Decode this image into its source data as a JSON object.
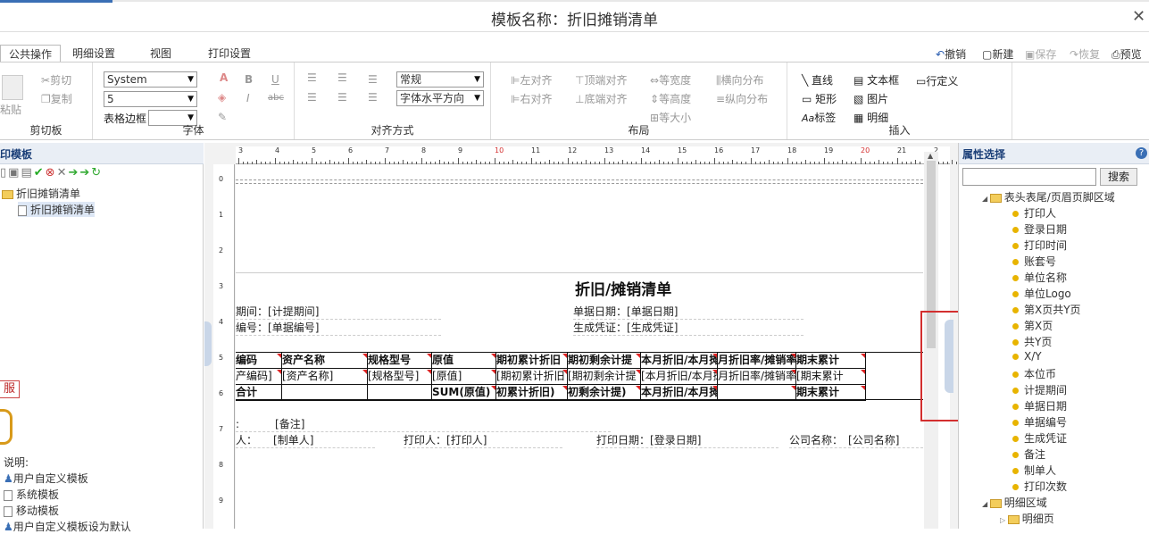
{
  "window": {
    "title": "模板名称：折旧摊销清单"
  },
  "tabs": [
    "公共操作",
    "明细设置",
    "视图",
    "打印设置"
  ],
  "toolbar": {
    "undo": "撤销",
    "new": "新建",
    "save": "保存",
    "restore": "恢复",
    "preview": "预览"
  },
  "clipboard": {
    "paste": "粘贴",
    "cut": "剪切",
    "copy": "复制",
    "label": "剪切板"
  },
  "font": {
    "family": "System",
    "size": "5",
    "border_label": "表格边框",
    "label": "字体",
    "bold": "B",
    "italic": "I",
    "underline": "U",
    "strike": "abc"
  },
  "align": {
    "style": "常规",
    "hmode": "字体水平方向",
    "label": "对齐方式"
  },
  "layout": {
    "left": "左对齐",
    "right": "右对齐",
    "top": "顶端对齐",
    "bottom": "底端对齐",
    "same_width": "等宽度",
    "same_height": "等高度",
    "same_size": "等大小",
    "h_dist": "横向分布",
    "v_dist": "纵向分布",
    "label": "布局"
  },
  "insert": {
    "line": "直线",
    "textbox": "文本框",
    "rowdef": "行定义",
    "rect": "矩形",
    "image": "图片",
    "label": "标签",
    "detail": "明细",
    "group": "插入"
  },
  "left": {
    "title": "印模板",
    "tree_root": "折旧摊销清单",
    "tree_child": "折旧摊销清单",
    "badge": "服",
    "legend_title": "说明:",
    "legend": [
      "用户自定义模板",
      "系统模板",
      "移动模板",
      "用户自定义模板设为默认"
    ]
  },
  "ruler": {
    "h": [
      "3",
      "4",
      "5",
      "6",
      "7",
      "8",
      "9",
      "10",
      "11",
      "12",
      "13",
      "14",
      "15",
      "16",
      "17",
      "18",
      "19",
      "20",
      "21",
      "2"
    ],
    "v": [
      "0",
      "1",
      "2",
      "3",
      "4",
      "5",
      "6",
      "7",
      "8",
      "9"
    ]
  },
  "report": {
    "title": "折旧/摊销清单",
    "period_label": "期间：",
    "period_value": "[计提期间]",
    "billdate_label": "单据日期：",
    "billdate_value": "[单据日期]",
    "billno_label": "编号：",
    "billno_value": "[单据编号]",
    "voucher_label": "生成凭证：",
    "voucher_value": "[生成凭证]",
    "headers": [
      "编码",
      "资产名称",
      "规格型号",
      "原值",
      "期初累计折旧",
      "期初剩余计提",
      "本月折旧/本月摊销",
      "月折旧率/摊销率",
      "期末累计"
    ],
    "fields": [
      "产编码]",
      "[资产名称]",
      "[规格型号]",
      "[原值]",
      "[期初累计折旧",
      "[期初剩余计提",
      "[本月折旧/本月摊销]",
      "月折旧率/摊销率]",
      "[期末累计"
    ],
    "totals": [
      "合计",
      "",
      "",
      "SUM(原值)",
      "初累计折旧)",
      "初剩余计提)",
      "本月折旧/本月摊销)",
      "",
      "期末累计"
    ],
    "note_label": ":",
    "note_value": "[备注]",
    "maker_label": "人：",
    "maker_value": "[制单人]",
    "printer_label": "打印人：",
    "printer_value": "[打印人]",
    "printdate_label": "打印日期：",
    "printdate_value": "[登录日期]",
    "company_label": "公司名称：",
    "company_value": "[公司名称]"
  },
  "right": {
    "title": "属性选择",
    "search_btn": "搜索",
    "group1": "表头表尾/页眉页脚区域",
    "items": [
      "打印人",
      "登录日期",
      "打印时间",
      "账套号",
      "单位名称",
      "单位Logo",
      "第X页共Y页",
      "第X页",
      "共Y页",
      "X/Y",
      "本位币",
      "计提期间",
      "单据日期",
      "单据编号",
      "生成凭证",
      "备注",
      "制单人",
      "打印次数"
    ],
    "group2": "明细区域",
    "group2_child": "明细页"
  },
  "colors": {
    "accent": "#1b3f78",
    "highlight": "#d32f2f"
  }
}
